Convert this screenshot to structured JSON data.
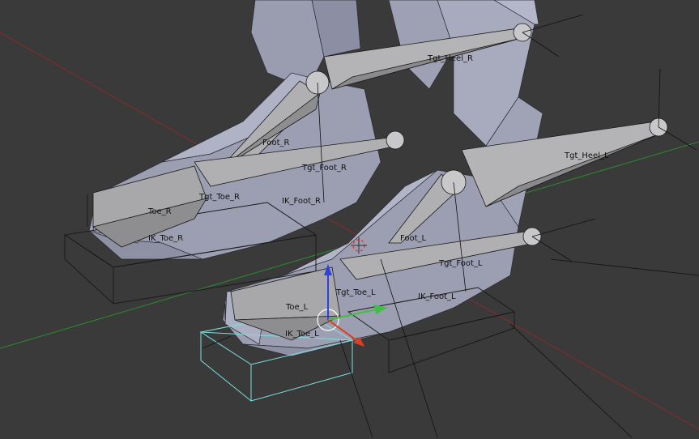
{
  "viewport": {
    "background_color": "#3a3a3a",
    "mesh_color": "#9ea0b4",
    "bone_color": "#a6a6a8",
    "selection_color": "#7fe0e0",
    "x_axis_color": "#8a2a2a",
    "y_axis_color": "#2e8a2e",
    "bones": [
      {
        "id": "tgt-heel-r",
        "label": "Tgt_Heel_R"
      },
      {
        "id": "foot-r",
        "label": "Foot_R"
      },
      {
        "id": "tgt-foot-r",
        "label": "Tgt_Foot_R"
      },
      {
        "id": "tgt-toe-r",
        "label": "Tgt_Toe_R"
      },
      {
        "id": "ik-foot-r",
        "label": "IK_Foot_R"
      },
      {
        "id": "toe-r",
        "label": "Toe_R"
      },
      {
        "id": "ik-toe-r",
        "label": "IK_Toe_R"
      },
      {
        "id": "tgt-heel-l",
        "label": "Tgt_Heel_L"
      },
      {
        "id": "foot-l",
        "label": "Foot_L"
      },
      {
        "id": "tgt-foot-l",
        "label": "Tgt_Foot_L"
      },
      {
        "id": "tgt-toe-l",
        "label": "Tgt_Toe_L"
      },
      {
        "id": "ik-foot-l",
        "label": "IK_Foot_L"
      },
      {
        "id": "toe-l",
        "label": "Toe_L"
      },
      {
        "id": "ik-toe-l",
        "label": "IK_Toe_L"
      }
    ],
    "gizmo": {
      "x_color": "#e04020",
      "y_color": "#40c040",
      "z_color": "#3040e0"
    }
  }
}
